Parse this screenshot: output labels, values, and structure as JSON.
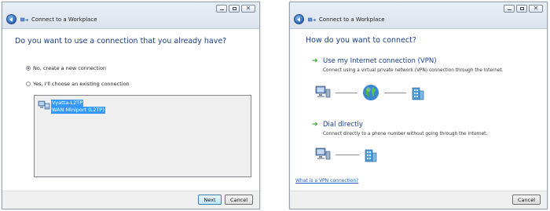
{
  "window_left": {
    "title": "Connect to a Workplace",
    "heading": "Do you want to use a connection that you already have?",
    "options": [
      {
        "label": "No, create a new connection",
        "selected": true
      },
      {
        "label": "Yes, I'll choose an existing connection",
        "selected": false
      }
    ],
    "existing_connection": {
      "name": "Vyatta-L2TP",
      "device": "WAN Miniport (L2TP)"
    },
    "buttons": {
      "next": "Next",
      "cancel": "Cancel"
    }
  },
  "window_right": {
    "title": "Connect to a Workplace",
    "heading": "How do you want to connect?",
    "options": [
      {
        "title": "Use my Internet connection (VPN)",
        "description": "Connect using a virtual private network (VPN) connection through the Internet."
      },
      {
        "title": "Dial directly",
        "description": "Connect directly to a phone number without going through the Internet."
      }
    ],
    "help_link": "What is a VPN connection?",
    "buttons": {
      "cancel": "Cancel"
    }
  },
  "colors": {
    "heading": "#1a3e8a",
    "selection": "#3399ff",
    "arrow": "#2fa82f",
    "link": "#1e5fbf"
  },
  "icons": [
    "back-arrow-icon",
    "network-icon",
    "computer-icon",
    "globe-icon",
    "building-icon",
    "green-arrow-icon"
  ]
}
